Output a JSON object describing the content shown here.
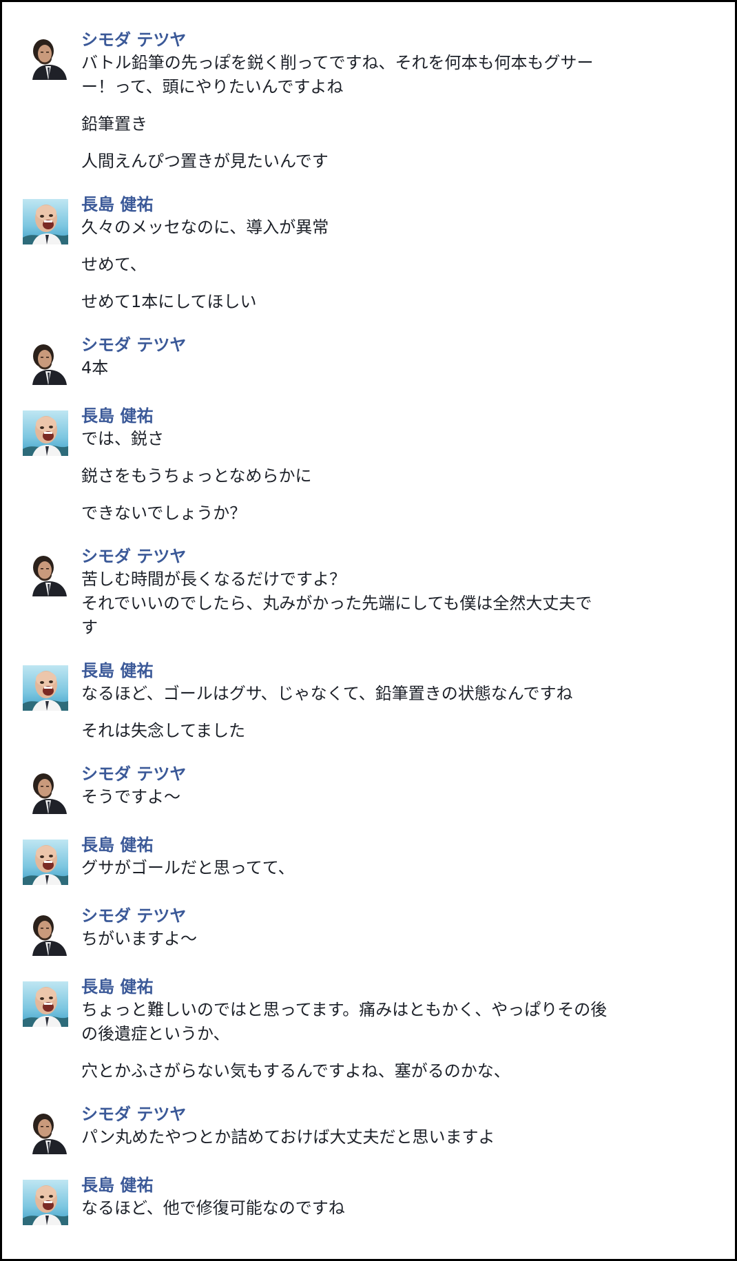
{
  "messages": [
    {
      "sender": "シモダ テツヤ",
      "avatar": "shimoda",
      "gap_after": 29,
      "lines": [
        "バトル鉛筆の先っぽを鋭く削ってですね、それを何本も何本もグサー\nー！って、頭にやりたいんですよね",
        "鉛筆置き",
        "人間えんぴつ置きが見たいんです"
      ]
    },
    {
      "sender": "長島 健祐",
      "avatar": "nagashima",
      "gap_after": 29,
      "lines": [
        "久々のメッセなのに、導入が異常",
        "せめて、",
        "せめて1本にしてほしい"
      ]
    },
    {
      "sender": "シモダ テツヤ",
      "avatar": "shimoda",
      "gap_after": 29,
      "lines": [
        "4本"
      ]
    },
    {
      "sender": "長島 健祐",
      "avatar": "nagashima",
      "gap_after": 29,
      "lines": [
        "では、鋭さ",
        "鋭さをもうちょっとなめらかに",
        "できないでしょうか？"
      ]
    },
    {
      "sender": "シモダ テツヤ",
      "avatar": "shimoda",
      "gap_after": 29,
      "lines": [
        "苦しむ時間が長くなるだけですよ？\nそれでいいのでしたら、丸みがかった先端にしても僕は全然大丈夫で\nす"
      ]
    },
    {
      "sender": "長島 健祐",
      "avatar": "nagashima",
      "gap_after": 29,
      "lines": [
        "なるほど、ゴールはグサ、じゃなくて、鉛筆置きの状態なんですね",
        "それは失念してました"
      ]
    },
    {
      "sender": "シモダ テツヤ",
      "avatar": "shimoda",
      "gap_after": 29,
      "lines": [
        "そうですよ〜"
      ]
    },
    {
      "sender": "長島 健祐",
      "avatar": "nagashima",
      "gap_after": 29,
      "lines": [
        "グサがゴールだと思ってて、"
      ]
    },
    {
      "sender": "シモダ テツヤ",
      "avatar": "shimoda",
      "gap_after": 29,
      "lines": [
        "ちがいますよ〜"
      ]
    },
    {
      "sender": "長島 健祐",
      "avatar": "nagashima",
      "gap_after": 29,
      "lines": [
        "ちょっと難しいのではと思ってます。痛みはともかく、やっぱりその後\nの後遺症というか、",
        "穴とかふさがらない気もするんですよね、塞がるのかな、"
      ]
    },
    {
      "sender": "シモダ テツヤ",
      "avatar": "shimoda",
      "gap_after": 29,
      "lines": [
        "パン丸めたやつとか詰めておけば大丈夫だと思いますよ"
      ]
    },
    {
      "sender": "長島 健祐",
      "avatar": "nagashima",
      "gap_after": 0,
      "lines": [
        "なるほど、他で修復可能なのですね"
      ]
    }
  ]
}
